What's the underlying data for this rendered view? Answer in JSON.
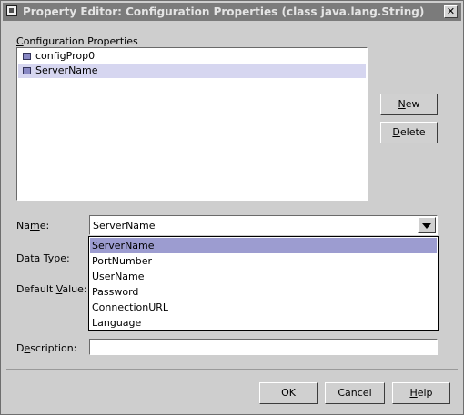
{
  "window": {
    "title": "Property Editor: Configuration Properties (class java.lang.String)",
    "close_glyph": "✕"
  },
  "config_properties": {
    "heading_prefix": "",
    "heading_mnemonic": "C",
    "heading_rest": "onfiguration Properties",
    "items": [
      {
        "label": "configProp0",
        "icon": "property-icon",
        "selected": false
      },
      {
        "label": "ServerName",
        "icon": "property-icon",
        "selected": true
      }
    ]
  },
  "buttons": {
    "new": {
      "mnemonic": "N",
      "rest": "ew"
    },
    "delete": {
      "mnemonic": "D",
      "rest": "elete"
    },
    "ok": {
      "label": "OK"
    },
    "cancel": {
      "label": "Cancel"
    },
    "help": {
      "mnemonic": "H",
      "rest": "elp"
    }
  },
  "form": {
    "name": {
      "prefix": "Na",
      "mnemonic": "m",
      "rest": "e:",
      "value": "ServerName"
    },
    "data_type": {
      "label": "Data Type:"
    },
    "default_value": {
      "prefix": "Default ",
      "mnemonic": "V",
      "rest": "alue:"
    },
    "description": {
      "prefix": "D",
      "mnemonic": "e",
      "rest": "scription:",
      "value": ""
    }
  },
  "name_dropdown": {
    "selected": "ServerName",
    "options": [
      "ServerName",
      "PortNumber",
      "UserName",
      "Password",
      "ConnectionURL",
      "Language"
    ]
  },
  "colors": {
    "titlebar": "#7b7b7b",
    "dialog": "#cecece",
    "list_selection": "#d6d6f0",
    "dropdown_selection": "#9c9cd0"
  }
}
